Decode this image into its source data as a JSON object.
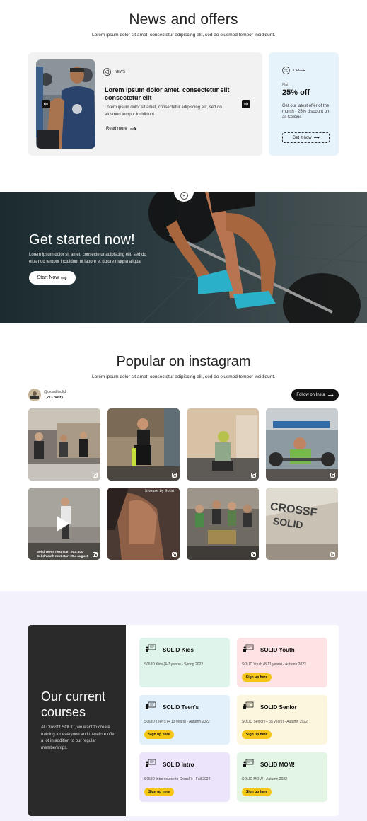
{
  "news": {
    "title": "News and offers",
    "subtitle": "Lorem ipsum dolor sit amet, consectetur adipiscing elit, sed do eiusmod tempor incididunt.",
    "item": {
      "tag": "NEWS",
      "title": "Lorem ipsum dolor amet, consectetur elit consectetur elit",
      "body": "Lorem ipsum dolor sit amet, consectetur adipiscing elit, sed do eiusmod tempor incididunt.",
      "read_more": "Read more"
    },
    "offer": {
      "tag": "OFFER",
      "small": "Flat",
      "big": "25% off",
      "text": "Get our latest offer of the month - 25% discount on all Celsius",
      "button": "Get it now"
    }
  },
  "hero": {
    "title": "Get started now!",
    "text": "Lorem ipsum dolor sit amet, consectetur adipiscing elit, sed do eiusmod tempor incididunt ut labore et dolore magna aliqua.",
    "button": "Start Now"
  },
  "instagram": {
    "title": "Popular on instagram",
    "subtitle": "Lorem ipsum dolor sit amet, consectetur adipiscing elit, sed do eiusmod tempor incididunt.",
    "handle": "@crossfitsolid",
    "posts": "1,273 posts",
    "follow": "Follow on Insta",
    "video_caption": "Solid Teens next start 24.a aug\nSolid Youth next start 29.a august",
    "tile6_caption": "Intense by Solid"
  },
  "courses": {
    "title": "Our current courses",
    "text": "At Crossfit SOLID, we want to create training for everyone and therefore offer a lot in addition to our regular memberships.",
    "items": [
      {
        "name": "SOLID Kids",
        "desc": "SOLID Kids (4-7 years) - Spring 2022",
        "button": "Sign up here",
        "color": "#dff5ec"
      },
      {
        "name": "SOLID Youth",
        "desc": "SOLID Youth (8-11 years) - Autumn 2022",
        "button": "Sign up here",
        "color": "#fde3e4"
      },
      {
        "name": "SOLID Teen's",
        "desc": "SOLID Teen's (+ 13 years) - Autumn 2022",
        "button": "Sign up here",
        "color": "#e1f0fa"
      },
      {
        "name": "SOLID Senior",
        "desc": "SOLID Senior (+ 65 years) - Autumn 2022",
        "button": "Sign up here",
        "color": "#fcf6df"
      },
      {
        "name": "SOLID Intro",
        "desc": "SOLID Intro course to CrossFit - Fall 2022",
        "button": "Sign up here",
        "color": "#ece4fa"
      },
      {
        "name": "SOLID MOM!",
        "desc": "SOLID MOM! - Autumn 2022",
        "button": "Sign up here",
        "color": "#e3f5e4"
      }
    ]
  }
}
